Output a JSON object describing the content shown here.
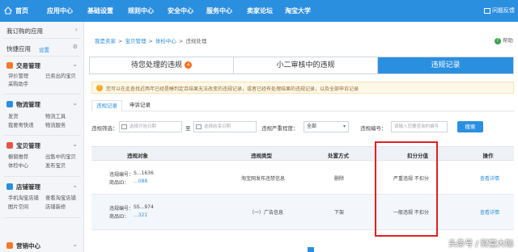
{
  "topnav": {
    "items": [
      "首页",
      "应用中心",
      "基础设置",
      "规则中心",
      "安全中心",
      "服务中心",
      "卖家论坛",
      "淘宝大学"
    ],
    "feedback": "问题反馈"
  },
  "sidebar": {
    "my_apps": "我订购的应用",
    "quick_apps": "快捷应用",
    "quick_settings": "设置",
    "sections": [
      {
        "title": "交易管理",
        "links": [
          "评价管理",
          "已卖出的宝贝",
          "采购助手"
        ],
        "color": "#f3792b",
        "icon": "trade-icon"
      },
      {
        "title": "物流管理",
        "links": [
          "发货",
          "物流工具",
          "我要寄快递",
          "物流服务"
        ],
        "color": "#2b8fe0",
        "icon": "logistics-icon"
      },
      {
        "title": "宝贝管理",
        "links": [
          "橱窗推荐",
          "出售中的宝贝",
          "体检中心",
          "发布宝贝"
        ],
        "color": "#e8534a",
        "icon": "goods-icon"
      },
      {
        "title": "店铺管理",
        "links": [
          "手机淘宝店铺",
          "查看淘宝店铺",
          "图片空间",
          "店铺装修"
        ],
        "color": "#2b8fe0",
        "icon": "store-icon"
      },
      {
        "title": "营销中心",
        "links": [],
        "color": "#f3792b",
        "icon": "marketing-icon"
      }
    ]
  },
  "breadcrumb": [
    "我是卖家",
    ">",
    "宝贝管理",
    ">",
    "体检中心",
    ">",
    "违规处理"
  ],
  "help_label": "帮助",
  "tabs": [
    {
      "label": "待您处理的违规",
      "badge": "4"
    },
    {
      "label": "小二审核中的违规",
      "badge": ""
    },
    {
      "label": "违规记录",
      "badge": ""
    }
  ],
  "notice": "您可以在此查找近两年已经是睡判定且结果无法改变的违规记录，或者已经有处理结果的违规记录，以及全部申诉记录",
  "subtabs": [
    "违规记录",
    "申诉记录"
  ],
  "filter": {
    "time_label": "违规筛选：",
    "start_placeholder": "选择开始日期",
    "sep": "至",
    "end_placeholder": "选择结束日期",
    "severity_label": "违规严重程度：",
    "severity_value": "全部",
    "id_label": "违规编号：",
    "id_placeholder": "请输入您要查询的编号",
    "search_button": "搜索"
  },
  "table": {
    "headers": [
      "违规对象",
      "违规类型",
      "处置方式",
      "扣分分值",
      "操作"
    ],
    "rows": [
      {
        "id_label": "违规编号：",
        "id_value": "S...1636",
        "item_label": "商品ID：",
        "item_value": "...088",
        "type": "淘宝网发布违禁信息",
        "action": "删除",
        "score": "严重违规 不扣分",
        "op": "查看详情"
      },
      {
        "id_label": "违规编号：",
        "id_value": "SS...974",
        "item_label": "商品ID：",
        "item_value": "...321",
        "type": "（一）广告信息",
        "action": "下架",
        "score": "一般违规 不扣分",
        "op": "查看详情"
      }
    ]
  },
  "watermark": "头条号 / 财富大咖"
}
